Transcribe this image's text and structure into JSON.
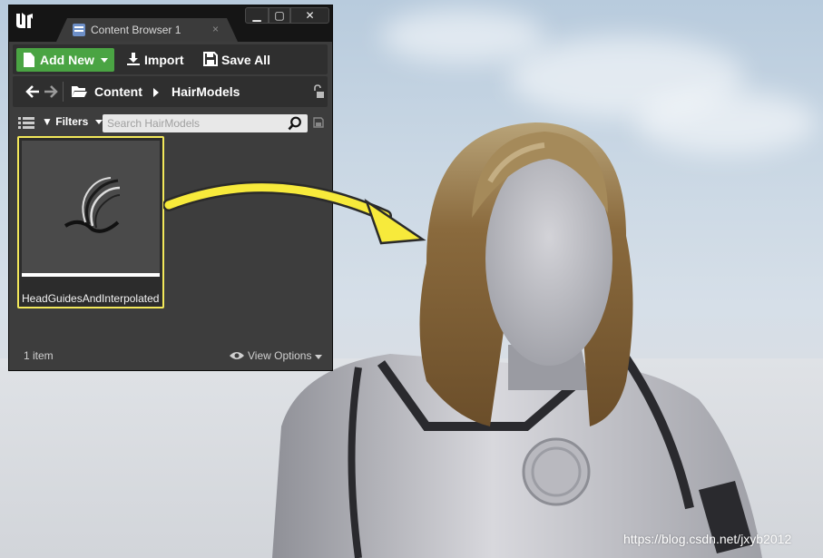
{
  "window": {
    "tab_label": "Content Browser 1",
    "tab_close": "×",
    "minimize": "▁",
    "maximize": "▢",
    "close": "✕"
  },
  "toolbar": {
    "add_new": "Add New",
    "import": "Import",
    "save_all": "Save All",
    "accent": "#4aa443"
  },
  "path": {
    "crumbs": [
      "Content",
      "HairModels"
    ]
  },
  "filters": {
    "label": "Filters",
    "search_placeholder": "Search HairModels"
  },
  "assets": [
    {
      "name": "HeadGuidesAndInterpolated",
      "icon": "hair-groom-icon",
      "selected": true
    }
  ],
  "footer": {
    "count": "1 item",
    "view_options": "View Options"
  },
  "annotation": {
    "arrow_color": "#f7ea3b"
  },
  "watermark": "https://blog.csdn.net/jxyb2012"
}
